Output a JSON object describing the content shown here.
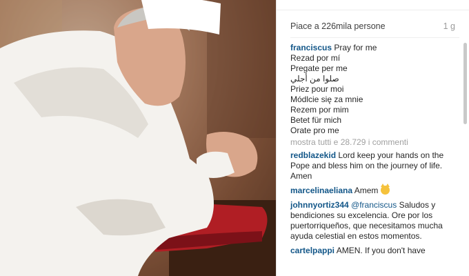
{
  "post": {
    "likes_text": "Piace a 226mila persone",
    "time_ago": "1 g"
  },
  "caption": {
    "username": "franciscus",
    "lines": [
      "Pray for me",
      "Rezad por mí",
      "Pregate per me",
      "صلوا من أجلي",
      "Priez pour moi",
      "Módlcie się za mnie",
      "Rezem por mim",
      "Betet für mich",
      "Orate pro me"
    ]
  },
  "show_all_comments": "mostra tutti e 28.729 i commenti",
  "comments": [
    {
      "username": "redblazekid",
      "text": "Lord keep your hands on the Pope and bless him on the journey of life. Amen"
    },
    {
      "username": "marcelinaeliana",
      "text": "Amem",
      "emoji": "smiling-cat-emoji"
    },
    {
      "username": "johnnyortiz344",
      "mention": "@franciscus",
      "text": "Saludos y bendiciones su excelencia. Ore por los puertorriqueños, que necesitamos mucha ayuda celestial en estos momentos."
    },
    {
      "username": "cartelpappi",
      "text": "AMEN. If you don't have"
    }
  ],
  "colors": {
    "username": "#125688",
    "muted": "#a0a0a0",
    "robe": "#f4f2ee",
    "cushion": "#b01e24"
  }
}
